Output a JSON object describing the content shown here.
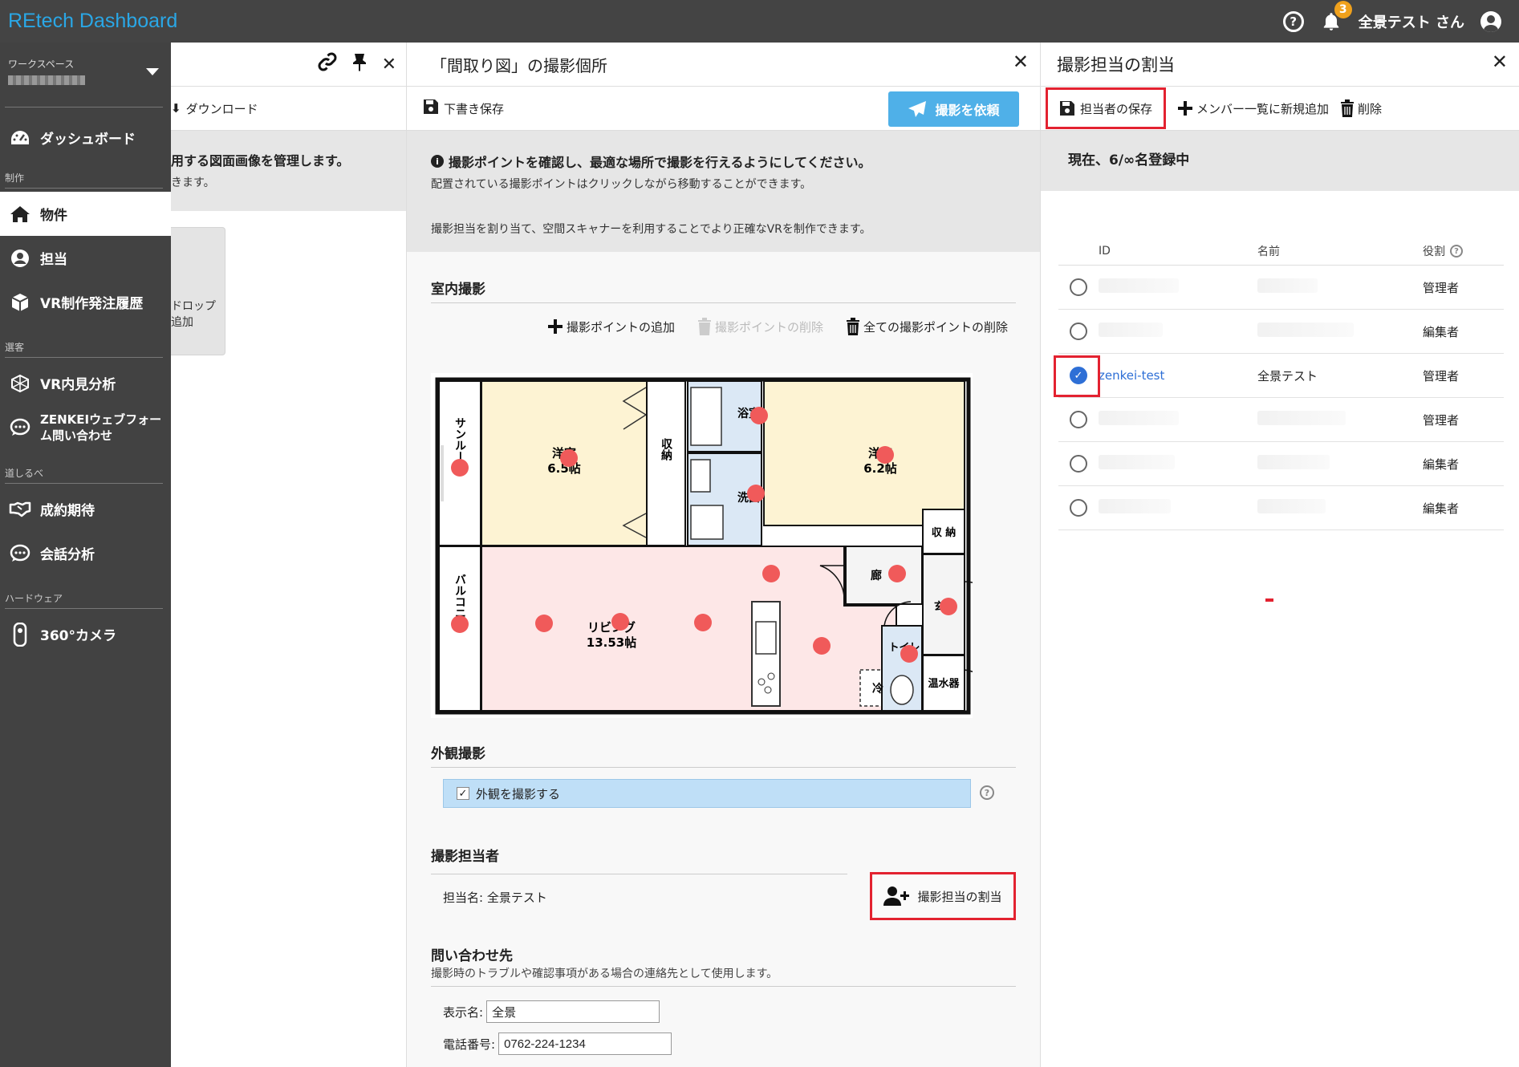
{
  "topbar": {
    "title": "REtech Dashboard",
    "help_glyph": "?",
    "notification_count": "3",
    "user_name": "全景テスト さん"
  },
  "sidebar": {
    "workspace_label": "ワークスペース",
    "items": [
      {
        "label": "ダッシュボード",
        "icon": "dashboard-icon"
      },
      {
        "section": "制作"
      },
      {
        "label": "物件",
        "icon": "home-icon",
        "active": true
      },
      {
        "label": "担当",
        "icon": "user-icon"
      },
      {
        "label": "VR制作発注履歴",
        "icon": "cube-icon"
      },
      {
        "section": "選客"
      },
      {
        "label": "VR内見分析",
        "icon": "vr-icon"
      },
      {
        "label": "ZENKEIウェブフォーム問い合わせ",
        "icon": "chat-icon"
      },
      {
        "section": "道しるべ"
      },
      {
        "label": "成約期待",
        "icon": "handshake-icon"
      },
      {
        "label": "会話分析",
        "icon": "chat-icon"
      },
      {
        "section": "ハードウェア"
      },
      {
        "label": "360°カメラ",
        "icon": "camera-icon"
      }
    ],
    "labels": {
      "dashboard": "ダッシュボード",
      "sec_production": "制作",
      "property": "物件",
      "staff": "担当",
      "vr_orders": "VR制作発注履歴",
      "sec_customer": "選客",
      "vr_analysis": "VR内見分析",
      "web_form_1": "ZENKEIウェブフォー",
      "web_form_2": "ム問い合わせ",
      "sec_guide": "道しるべ",
      "contract": "成約期待",
      "conversation": "会話分析",
      "sec_hardware": "ハードウェア",
      "camera": "360°カメラ"
    }
  },
  "left_panel": {
    "download_label": "ダウンロード",
    "info_title": "用する図面画像を管理します。",
    "info_sub": "きます。",
    "drop_line1": "ドロップ",
    "drop_line2": "追加"
  },
  "mid_panel": {
    "title": "「間取り図」の撮影個所",
    "draft_save": "下書き保存",
    "request_button": "撮影を依頼",
    "info_main": "撮影ポイントを確認し、最適な場所で撮影を行えるようにしてください。",
    "info_sub1": "配置されている撮影ポイントはクリックしながら移動することができます。",
    "info_sub2": "撮影担当を割り当て、空間スキャナーを利用することでより正確なVRを制作できます。",
    "indoor_title": "室内撮影",
    "add_point": "撮影ポイントの追加",
    "delete_point": "撮影ポイントの削除",
    "delete_all_points": "全ての撮影ポイントの削除",
    "floorplan": {
      "rooms": {
        "sunroom": "サンルーム",
        "room1_name": "洋室",
        "room1_size": "6.5帖",
        "storage1": "収納",
        "bath": "浴室",
        "washroom": "洗面",
        "room2_name": "洋室",
        "room2_size": "6.2帖",
        "storage2": "収 納",
        "balcony": "バルコニー",
        "living_name": "リビング",
        "living_size": "13.53帖",
        "hallway": "廊",
        "entrance": "玄関",
        "toilet": "トイレ",
        "fridge": "冷",
        "water_heater": "温水器"
      }
    },
    "exterior_title": "外観撮影",
    "exterior_checkbox": "外観を撮影する",
    "exterior_checked": "✓",
    "photographer_title": "撮影担当者",
    "assign_button": "撮影担当の割当",
    "assigned_label": "担当名: 全景テスト",
    "contact_title": "問い合わせ先",
    "contact_sub": "撮影時のトラブルや確認事項がある場合の連絡先として使用します。",
    "display_name_label": "表示名:",
    "display_name_value": "全景",
    "phone_label": "電話番号:",
    "phone_value": "0762-224-1234"
  },
  "right_panel": {
    "title": "撮影担当の割当",
    "save_button": "担当者の保存",
    "add_member": "メンバー一覧に新規追加",
    "delete": "削除",
    "status": "現在、6/∞名登録中",
    "columns": {
      "id": "ID",
      "name": "名前",
      "role": "役割"
    },
    "rows": [
      {
        "id": "",
        "name": "",
        "role": "管理者",
        "checked": false
      },
      {
        "id": "",
        "name": "",
        "role": "編集者",
        "checked": false
      },
      {
        "id": "zenkei-test",
        "name": "全景テスト",
        "role": "管理者",
        "checked": true
      },
      {
        "id": "",
        "name": "",
        "role": "管理者",
        "checked": false
      },
      {
        "id": "",
        "name": "",
        "role": "編集者",
        "checked": false
      },
      {
        "id": "",
        "name": "",
        "role": "編集者",
        "checked": false
      }
    ]
  },
  "colors": {
    "topbar": "#444444",
    "brand": "#2aa7e6",
    "sidebar": "#424242",
    "primary_button": "#4fb0e8",
    "highlight_frame": "#e32230",
    "shooting_point": "#f05a5a",
    "room_yellow": "#fdf3d3",
    "room_blue": "#dbe8f5",
    "room_pink": "#fde7e7"
  }
}
